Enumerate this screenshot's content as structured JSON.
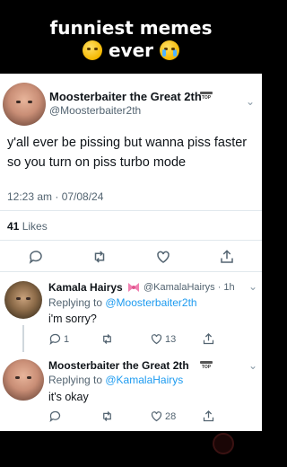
{
  "banner": {
    "line1": "funniest memes",
    "line2": "ever"
  },
  "tweet": {
    "author_name": "Moosterbaiter the Great 2th",
    "handle": "@Moosterbaiter2th",
    "badge": "TOP",
    "text": "y'all ever be pissing but wanna piss faster so you turn on piss turbo mode",
    "timestamp": "12:23 am · 07/08/24",
    "likes_count": "41",
    "likes_label": " Likes"
  },
  "reply1": {
    "author_name": "Kamala Hairys",
    "handle_time": "@KamalaHairys · 1h",
    "replying_prefix": "Replying to ",
    "replying_to": "@Moosterbaiter2th",
    "text": "i'm sorry?",
    "reply_count": "1",
    "like_count": "13"
  },
  "reply2": {
    "author_name": "Moosterbaiter the Great 2th",
    "badge": "TOP",
    "replying_prefix": "Replying to ",
    "replying_to": "@KamalaHairys",
    "text": "it's okay",
    "like_count": "28"
  },
  "icons": {
    "reply": "reply-icon",
    "retweet": "retweet-icon",
    "like": "heart-icon",
    "share": "share-icon",
    "bow": "bow-icon",
    "more": "chevron-down-icon"
  },
  "colors": {
    "link": "#1d9bf0",
    "muted": "#536471",
    "text": "#0f1419",
    "banner_bg": "#000000"
  }
}
